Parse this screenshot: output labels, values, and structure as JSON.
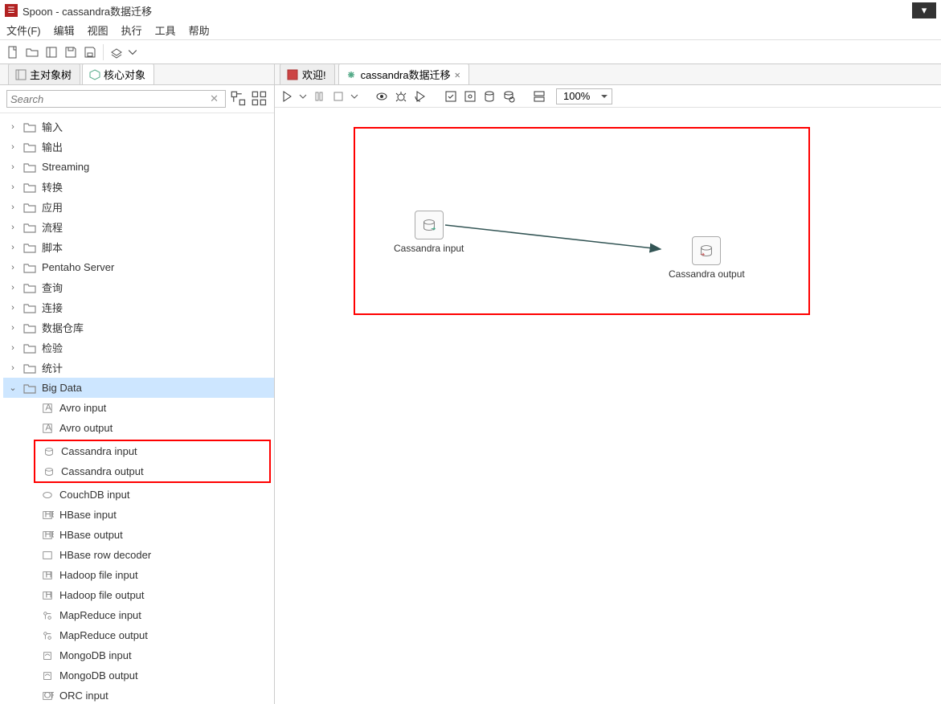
{
  "window": {
    "title": "Spoon - cassandra数据迁移"
  },
  "menu": {
    "file": "文件(F)",
    "edit": "编辑",
    "view": "视图",
    "exec": "执行",
    "tools": "工具",
    "help": "帮助"
  },
  "left_tabs": {
    "main_tree": "主对象树",
    "core_obj": "核心对象"
  },
  "search": {
    "placeholder": "Search"
  },
  "tree": {
    "folders": [
      {
        "label": "输入"
      },
      {
        "label": "输出"
      },
      {
        "label": "Streaming"
      },
      {
        "label": "转换"
      },
      {
        "label": "应用"
      },
      {
        "label": "流程"
      },
      {
        "label": "脚本"
      },
      {
        "label": "Pentaho Server"
      },
      {
        "label": "查询"
      },
      {
        "label": "连接"
      },
      {
        "label": "数据仓库"
      },
      {
        "label": "检验"
      },
      {
        "label": "统计"
      }
    ],
    "bigdata": {
      "label": "Big Data",
      "children": [
        {
          "label": "Avro input"
        },
        {
          "label": "Avro output"
        },
        {
          "label": "Cassandra input"
        },
        {
          "label": "Cassandra output"
        },
        {
          "label": "CouchDB input"
        },
        {
          "label": "HBase input"
        },
        {
          "label": "HBase output"
        },
        {
          "label": "HBase row decoder"
        },
        {
          "label": "Hadoop file input"
        },
        {
          "label": "Hadoop file output"
        },
        {
          "label": "MapReduce input"
        },
        {
          "label": "MapReduce output"
        },
        {
          "label": "MongoDB input"
        },
        {
          "label": "MongoDB output"
        },
        {
          "label": "ORC input"
        }
      ]
    }
  },
  "editor_tabs": {
    "welcome": "欢迎!",
    "transform": "cassandra数据迁移"
  },
  "zoom": {
    "value": "100%"
  },
  "canvas": {
    "step_in": "Cassandra input",
    "step_out": "Cassandra output"
  }
}
